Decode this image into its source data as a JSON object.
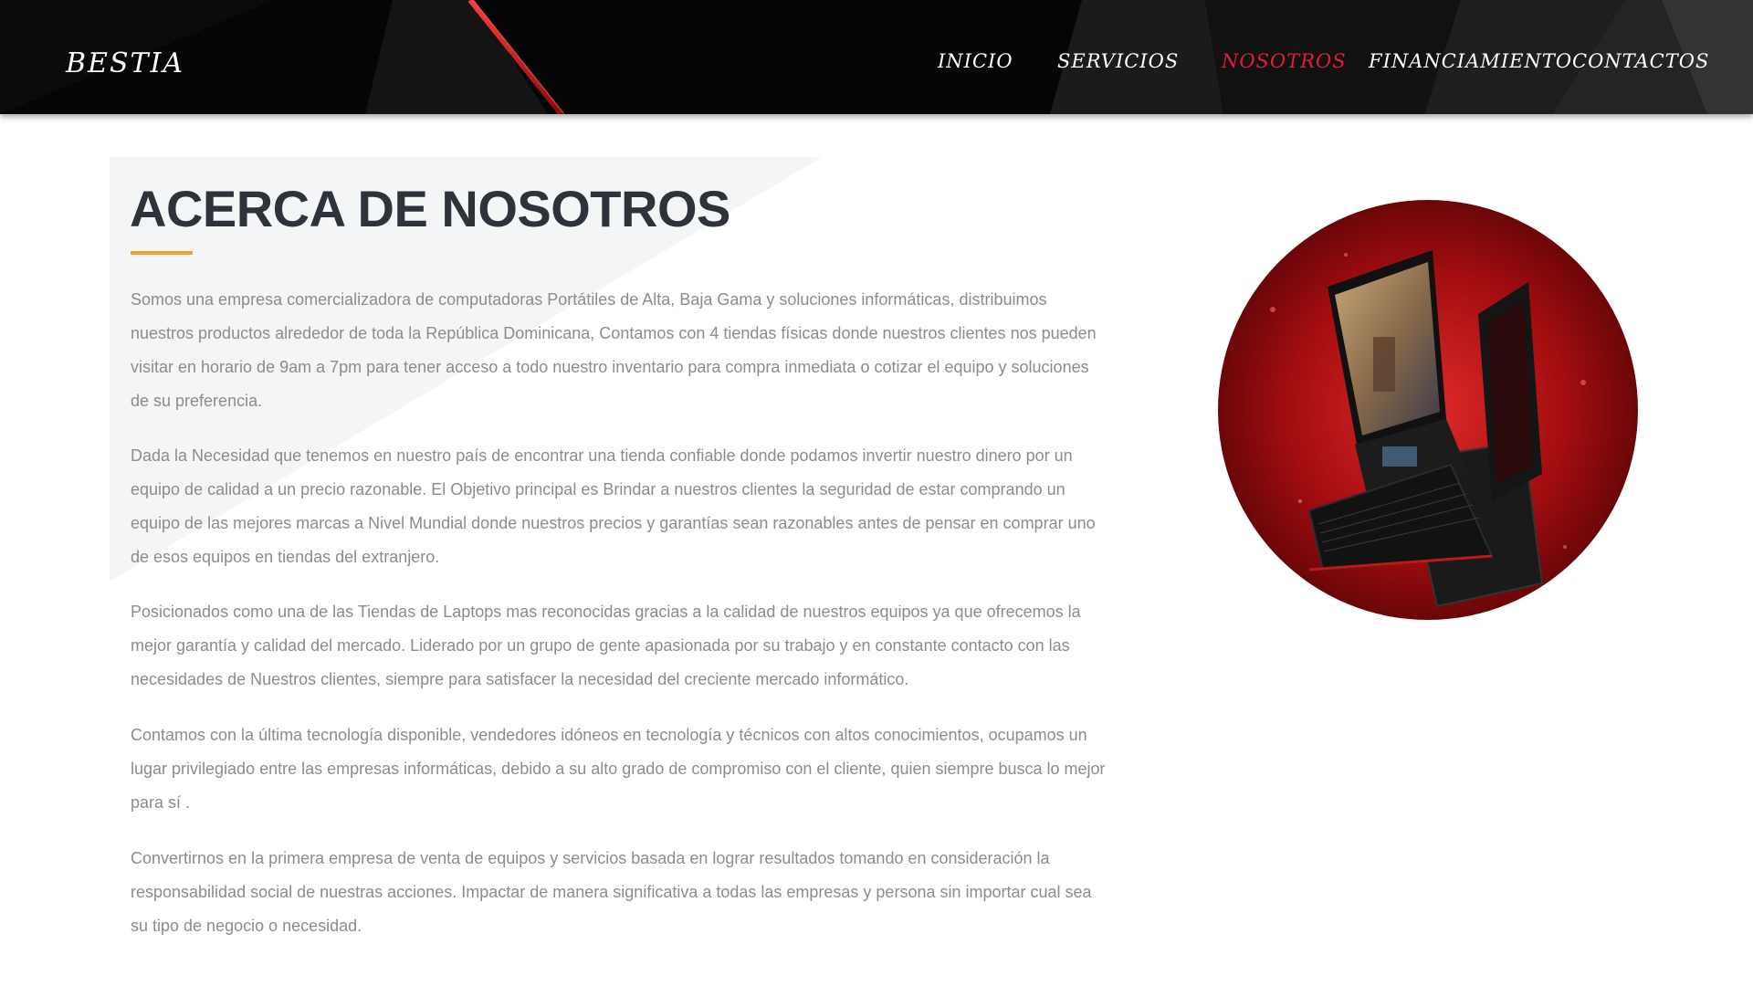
{
  "header": {
    "logo": "BESTIA",
    "nav": {
      "inicio": "INICIO",
      "servicios": "SERVICIOS",
      "nosotros": "NOSOTROS",
      "financiamiento": "FINANCIAMIENTO",
      "contactos": "CONTACTOS"
    },
    "active_item": "NOSOTROS"
  },
  "about": {
    "title": "ACERCA DE NOSOTROS",
    "paragraphs": [
      "Somos una empresa comercializadora de computadoras Portátiles de Alta, Baja Gama y soluciones informáticas, distribuimos nuestros productos alrededor de toda la República Dominicana, Contamos con 4 tiendas físicas donde nuestros clientes nos pueden visitar en horario de 9am a 7pm para tener acceso a todo nuestro inventario para compra inmediata o cotizar el equipo y soluciones de su preferencia.",
      "Dada la Necesidad que tenemos en nuestro país de encontrar una tienda confiable donde podamos invertir nuestro dinero por un equipo de calidad a un precio razonable. El Objetivo principal  es Brindar a nuestros clientes la seguridad de estar comprando un equipo de las mejores marcas a Nivel Mundial donde nuestros precios y garantías sean razonables antes de pensar en comprar uno de esos equipos en tiendas del extranjero.",
      "Posicionados como una de las Tiendas de Laptops mas reconocidas gracias a la calidad de nuestros equipos ya que ofrecemos la mejor garantía y calidad del mercado. Liderado por un grupo de gente apasionada por su trabajo y en constante contacto con las necesidades de Nuestros clientes, siempre para satisfacer la necesidad del creciente mercado informático.",
      "Contamos con la última tecnología disponible, vendedores idóneos en tecnología y técnicos con altos conocimientos, ocupamos un lugar privilegiado entre las empresas informáticas, debido a su alto grado de compromiso con el cliente, quien siempre busca lo mejor para sí .",
      "Convertirnos en la primera empresa de venta de equipos y servicios basada en lograr resultados tomando en consideración la responsabilidad social de nuestras acciones. Impactar de manera significativa a todas las empresas y persona sin importar cual sea su tipo de negocio o necesidad."
    ]
  },
  "colors": {
    "header_bg": "#050505",
    "accent_red": "#e01e3c",
    "underline": "#f0a030",
    "title": "#2e323b",
    "body_text": "#8c8c8c"
  },
  "icons": [
    "laptop-image"
  ]
}
